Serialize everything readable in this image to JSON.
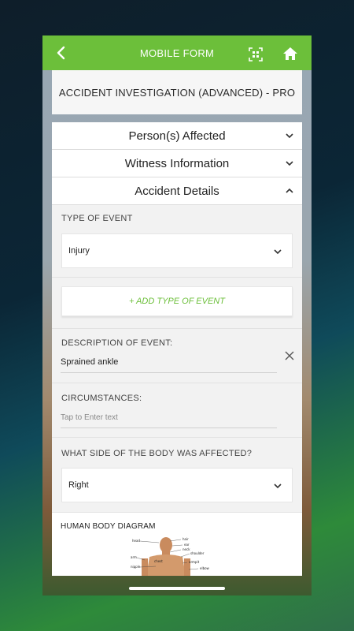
{
  "header": {
    "title": "MOBILE FORM"
  },
  "form": {
    "name": "ACCIDENT INVESTIGATION (ADVANCED) - PRO"
  },
  "sections": [
    {
      "label": "Person(s) Affected",
      "state": "collapsed"
    },
    {
      "label": "Witness Information",
      "state": "collapsed"
    },
    {
      "label": "Accident Details",
      "state": "expanded"
    }
  ],
  "details": {
    "type_of_event": {
      "label": "TYPE OF EVENT",
      "value": "Injury"
    },
    "add_type_label": "+ ADD TYPE OF EVENT",
    "description": {
      "label": "DESCRIPTION OF EVENT:",
      "value": "Sprained ankle"
    },
    "circumstances": {
      "label": "CIRCUMSTANCES:",
      "placeholder": "Tap to Enter text"
    },
    "body_side": {
      "label": "WHAT SIDE OF THE BODY WAS AFFECTED?",
      "value": "Right"
    },
    "body_diagram": {
      "label": "HUMAN BODY DIAGRAM",
      "parts": [
        "head",
        "hair",
        "ear",
        "neck",
        "shoulder",
        "arm",
        "chest",
        "armpit",
        "nipple",
        "elbow"
      ]
    }
  },
  "colors": {
    "accent": "#6cbf3a"
  }
}
